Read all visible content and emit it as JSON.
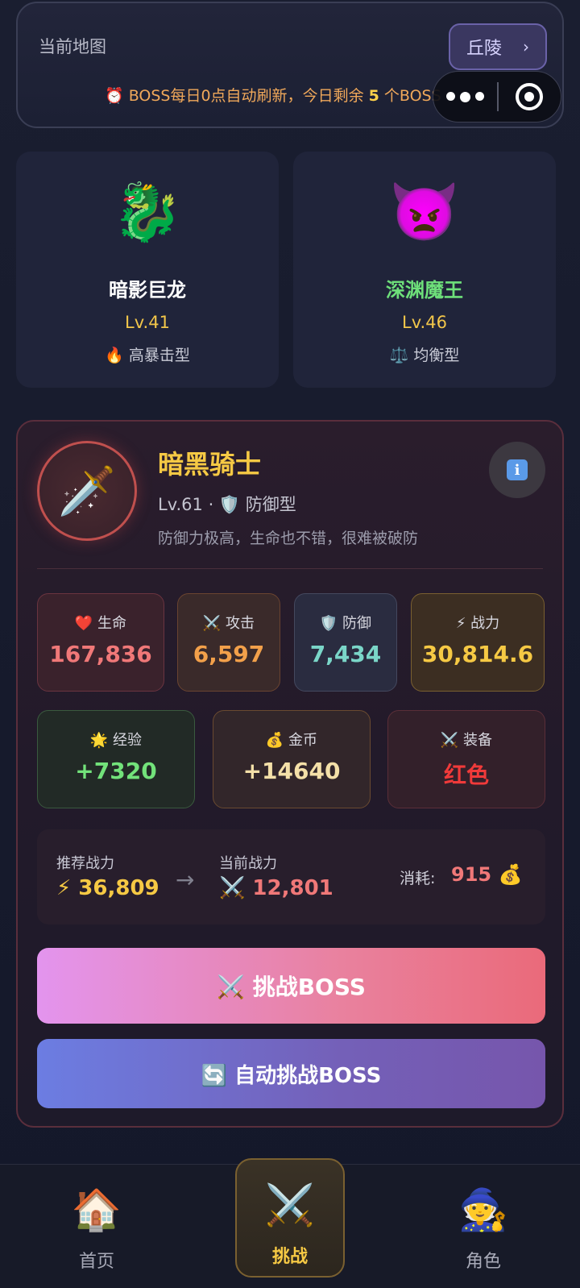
{
  "map": {
    "label": "当前地图",
    "current": "丘陵",
    "chevron": "›",
    "refresh_prefix": "⏰ BOSS每日0点自动刷新，今日剩余",
    "refresh_count": "5",
    "refresh_suffix": "个BOSS"
  },
  "boss_options": [
    {
      "emoji": "🐉",
      "name": "暗影巨龙",
      "level": "Lv.41",
      "type": "🔥 高暴击型"
    },
    {
      "emoji": "👿",
      "name": "深渊魔王",
      "level": "Lv.46",
      "type": "⚖️ 均衡型"
    }
  ],
  "selected_boss": {
    "avatar_emoji": "🗡️",
    "name": "暗黑骑士",
    "meta": "Lv.61 · 🛡️ 防御型",
    "description": "防御力极高，生命也不错，很难被破防",
    "info_icon": "i",
    "stats": {
      "hp_label": "❤️ 生命",
      "hp_value": "167,836",
      "atk_label": "⚔️ 攻击",
      "atk_value": "6,597",
      "def_label": "🛡️ 防御",
      "def_value": "7,434",
      "power_label": "⚡ 战力",
      "power_value": "30,814.6"
    },
    "rewards": {
      "exp_label": "🌟 经验",
      "exp_value": "+7320",
      "gold_label": "💰 金币",
      "gold_value": "+14640",
      "equip_label": "⚔️ 装备",
      "equip_value": "红色"
    },
    "power_compare": {
      "recommended_label": "推荐战力",
      "recommended_value": "⚡ 36,809",
      "arrow": "→",
      "current_label": "当前战力",
      "current_value": "⚔️ 12,801",
      "cost_label": "消耗:",
      "cost_value": "915 💰"
    },
    "challenge_button": "⚔️ 挑战BOSS",
    "auto_button": "🔄 自动挑战BOSS"
  },
  "tabbar": [
    {
      "icon": "🏠",
      "label": "首页"
    },
    {
      "icon": "⚔️",
      "label": "挑战",
      "active": true
    },
    {
      "icon": "🧙",
      "label": "角色"
    }
  ],
  "colors": {
    "accent_gold": "#f6c944",
    "accent_red": "#f07878",
    "accent_green": "#72e27a"
  }
}
